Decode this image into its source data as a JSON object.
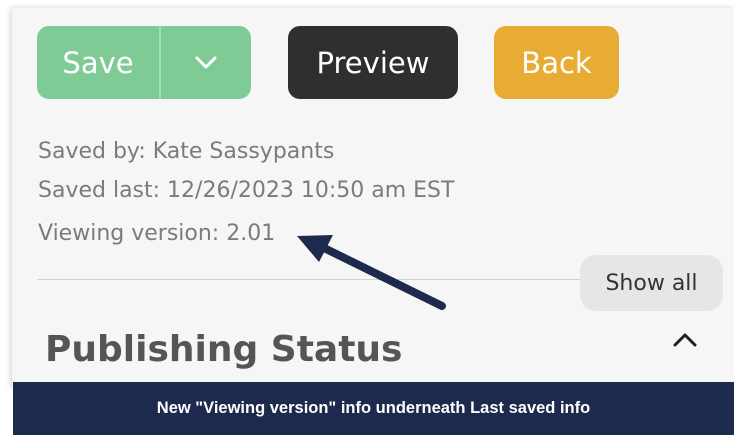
{
  "toolbar": {
    "save_label": "Save",
    "preview_label": "Preview",
    "back_label": "Back"
  },
  "meta": {
    "saved_by": "Saved by: Kate Sassypants",
    "saved_last": "Saved last: 12/26/2023 10:50 am EST",
    "viewing_version": "Viewing version: 2.01"
  },
  "show_all_label": "Show all",
  "section": {
    "title": "Publishing Status"
  },
  "caption": "New \"Viewing version\" info underneath Last saved info",
  "icons": {
    "save_dropdown": "chevron-down-icon",
    "collapse": "chevron-up-icon",
    "annotation": "arrow-icon"
  },
  "colors": {
    "save": "#7fcb96",
    "preview": "#2f2f2f",
    "back": "#e8ac34",
    "caption_bar": "#1d2a4d",
    "arrow": "#1d2a4d"
  }
}
